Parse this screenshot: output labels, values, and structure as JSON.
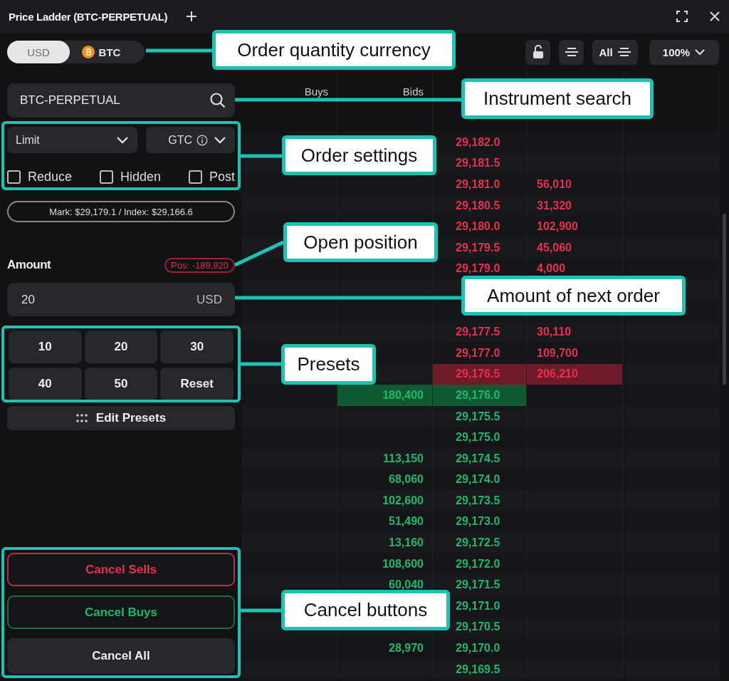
{
  "window": {
    "title": "Price Ladder (BTC-PERPETUAL)"
  },
  "currency_toggle": [
    {
      "label": "USD",
      "selected": true
    },
    {
      "label": "BTC",
      "selected": false
    }
  ],
  "toolbar": {
    "filter_label": "All",
    "zoom": "100%"
  },
  "instrument_search": {
    "value": "BTC-PERPETUAL"
  },
  "order_type": "Limit",
  "time_in_force": "GTC",
  "flags": [
    {
      "label": "Reduce",
      "checked": false
    },
    {
      "label": "Hidden",
      "checked": false
    },
    {
      "label": "Post",
      "checked": false
    }
  ],
  "mark_index": "Mark: $29,179.1 / Index: $29,166.6",
  "amount": {
    "label": "Amount",
    "position": "Pos: -189,920",
    "value": "20",
    "unit": "USD"
  },
  "presets": [
    "10",
    "20",
    "30",
    "40",
    "50",
    "Reset"
  ],
  "edit_presets": "Edit Presets",
  "cancel_buttons": [
    {
      "label": "Cancel Sells",
      "kind": "sells"
    },
    {
      "label": "Cancel Buys",
      "kind": "buys"
    },
    {
      "label": "Cancel All",
      "kind": "all"
    }
  ],
  "ladder": {
    "columns": [
      "Buys",
      "Bids"
    ],
    "rows": [
      {
        "price": "29,182.0",
        "kind": "ask",
        "best": false
      },
      {
        "price": "29,181.5",
        "kind": "ask",
        "best": false
      },
      {
        "price": "29,181.0",
        "asks": "56,010",
        "kind": "ask",
        "best": false
      },
      {
        "price": "29,180.5",
        "asks": "31,320",
        "kind": "ask",
        "best": false
      },
      {
        "price": "29,180.0",
        "asks": "102,900",
        "kind": "ask",
        "best": false
      },
      {
        "price": "29,179.5",
        "asks": "45,060",
        "kind": "ask",
        "best": false
      },
      {
        "price": "29,179.0",
        "asks": "4,000",
        "kind": "ask",
        "best": false
      },
      {
        "best": false
      },
      {
        "best": false
      },
      {
        "price": "29,177.5",
        "asks": "30,110",
        "kind": "ask",
        "best": false
      },
      {
        "price": "29,177.0",
        "asks": "109,700",
        "kind": "ask",
        "best": false
      },
      {
        "price": "29,176.5",
        "asks": "206,210",
        "kind": "ask",
        "best": true
      },
      {
        "price": "29,176.0",
        "bids": "180,400",
        "kind": "bid",
        "best": true
      },
      {
        "price": "29,175.5",
        "kind": "bid",
        "best": false
      },
      {
        "price": "29,175.0",
        "kind": "bid",
        "best": false
      },
      {
        "price": "29,174.5",
        "bids": "113,150",
        "kind": "bid",
        "best": false
      },
      {
        "price": "29,174.0",
        "bids": "68,060",
        "kind": "bid",
        "best": false
      },
      {
        "price": "29,173.5",
        "bids": "102,600",
        "kind": "bid",
        "best": false
      },
      {
        "price": "29,173.0",
        "bids": "51,490",
        "kind": "bid",
        "best": false
      },
      {
        "price": "29,172.5",
        "bids": "13,160",
        "kind": "bid",
        "best": false
      },
      {
        "price": "29,172.0",
        "bids": "108,600",
        "kind": "bid",
        "best": false
      },
      {
        "price": "29,171.5",
        "bids": "60,040",
        "kind": "bid",
        "best": false
      },
      {
        "price": "29,171.0",
        "kind": "bid",
        "best": false
      },
      {
        "price": "29,170.5",
        "kind": "bid",
        "best": false
      },
      {
        "price": "29,170.0",
        "bids": "28,970",
        "kind": "bid",
        "best": false
      },
      {
        "price": "29,169.5",
        "kind": "bid",
        "best": false
      }
    ]
  },
  "callouts": [
    {
      "label": "Order quantity currency"
    },
    {
      "label": "Instrument search"
    },
    {
      "label": "Order settings"
    },
    {
      "label": "Open position"
    },
    {
      "label": "Amount of next order"
    },
    {
      "label": "Presets"
    },
    {
      "label": "Cancel buttons"
    }
  ]
}
